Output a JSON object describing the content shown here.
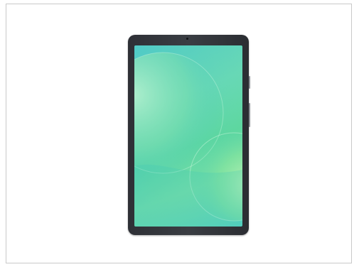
{
  "product": {
    "description_icon": "tablet-device-icon",
    "bezel_color": "#34363c",
    "screen_colors": [
      "#5fd1c4",
      "#6fdcb6",
      "#5ed89c",
      "#7fe2a5"
    ]
  }
}
